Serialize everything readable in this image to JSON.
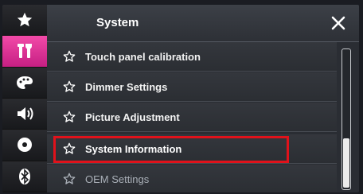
{
  "header": {
    "title": "System"
  },
  "rail": {
    "items": [
      {
        "icon": "star-icon"
      },
      {
        "icon": "settings-tools-icon",
        "active": true
      },
      {
        "icon": "palette-icon"
      },
      {
        "icon": "speaker-icon"
      },
      {
        "icon": "disc-icon"
      },
      {
        "icon": "bluetooth-icon"
      }
    ]
  },
  "menu": {
    "items": [
      {
        "label": "Touch panel calibration",
        "icon": "star-outline-icon"
      },
      {
        "label": "Dimmer Settings",
        "icon": "star-outline-icon"
      },
      {
        "label": "Picture Adjustment",
        "icon": "star-outline-icon"
      },
      {
        "label": "System Information",
        "icon": "star-outline-icon",
        "highlighted": true
      },
      {
        "label": "OEM Settings",
        "icon": "star-outline-icon",
        "dimmed": true
      }
    ]
  },
  "scrollbar": {
    "position": 0.9
  },
  "colors": {
    "accent": "#e0338f",
    "highlight_border": "#e0121b",
    "header_bg": "#3a3d44"
  }
}
